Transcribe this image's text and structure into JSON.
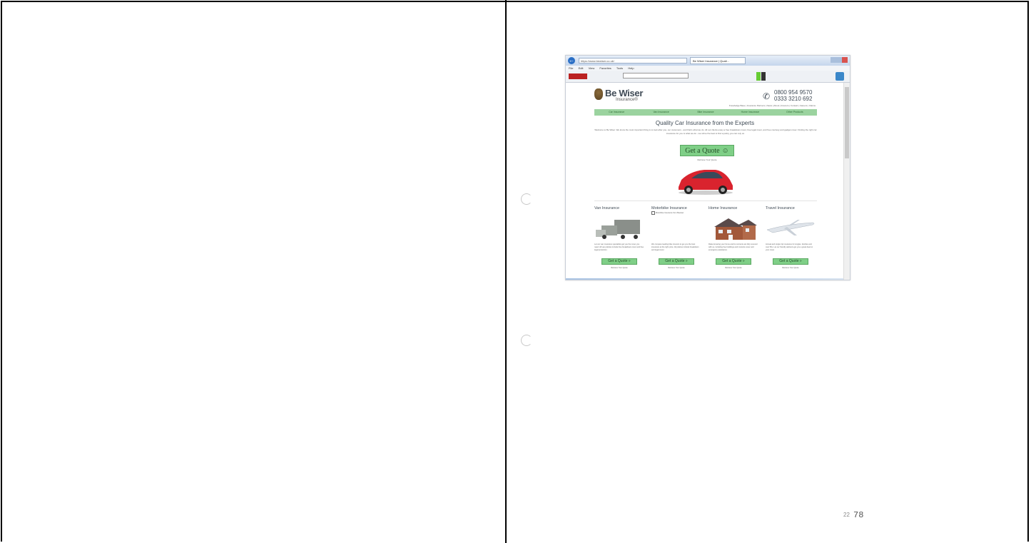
{
  "left_cell": {},
  "screenshot": {
    "browser": {
      "address": "https://www.bewiser.co.uk/",
      "tab_title": "Be Wiser Insurance | Quali...",
      "menu": [
        "File",
        "Edit",
        "View",
        "Favorites",
        "Tools",
        "Help"
      ]
    },
    "site": {
      "brand_name": "Be Wiser",
      "brand_sub": "Insurance®",
      "phone_1": "0800 954 9570",
      "phone_2": "0333 3210 692",
      "top_links": "Knowledge Base | Insurance Partners | News | About | Insurers | Contact | Careers | Claims",
      "nav": [
        "Car Insurance",
        "Van Insurance",
        "Bike Insurance",
        "Home Insurance",
        "Other Products"
      ],
      "hero_title": "Quality Car Insurance from the Experts",
      "hero_text": "Welcome to Be Wiser. We know the most important thing is to look after you, our customers - and that's what we do. All our clients enjoy a free breakdown cover, free legal cover, and free courtesy and gadget cover. Finding the right car insurance for you is what we do - we strive the best to find a policy you can rely on.",
      "cta_label": "Get a Quote",
      "cta_sub": "Retrieve Your Quote",
      "products": [
        {
          "title": "Van Insurance",
          "text": "Let our van insurance specialists get you the cover you need. All van policies include free breakdown cover and free legal protection.",
          "button": "Get a Quote »",
          "sub": "Retrieve Your Quote"
        },
        {
          "title": "Motorbike Insurance",
          "checkbox": "Motorbike Insurance from Bewiser",
          "text": "We compare leading bike insurers to get you the best insurance at the right price. All policies include breakdown and legal cover.",
          "button": "Get a Quote »",
          "sub": "Retrieve Your Quote"
        },
        {
          "title": "Home Insurance",
          "text": "Relax knowing your home and its contents are fully covered with us, including free buildings and contents cover and emergency assistance.",
          "button": "Get a Quote »",
          "sub": "Retrieve Your Quote"
        },
        {
          "title": "Travel Insurance",
          "text": "Annual and single trip insurance for singles, families and over 50s. Let our friendly advisors get you a great deal on your cover.",
          "button": "Get a Quote »",
          "sub": "Retrieve Your Quote"
        }
      ]
    }
  },
  "page_marks": {
    "small_number": "22",
    "page_number": "78"
  },
  "colors": {
    "nav_green": "#9bd39f",
    "button_green": "#7fcf87",
    "brand_text": "#3f4a55",
    "car_red": "#d9232e"
  }
}
